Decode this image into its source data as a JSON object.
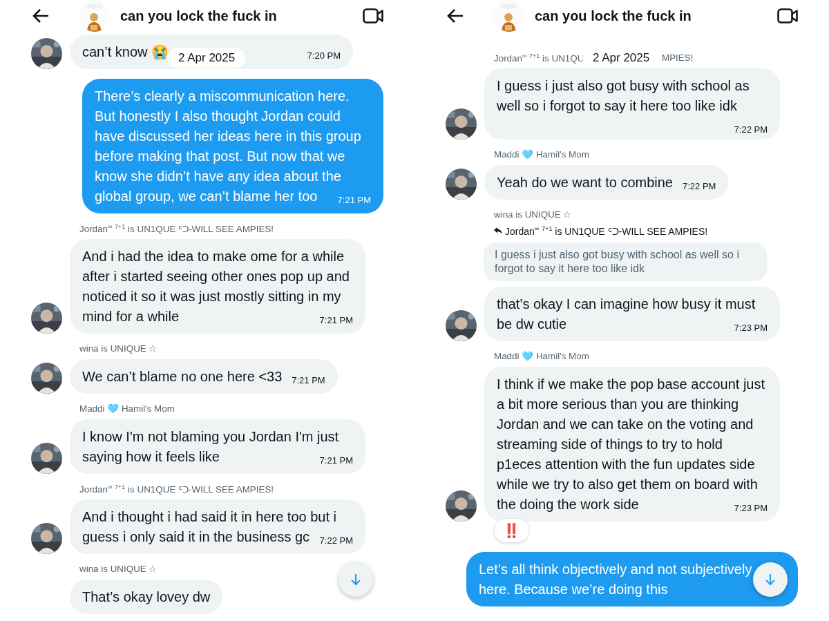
{
  "panels": [
    {
      "header": {
        "title": "can you lock the fuck in"
      },
      "date_pill": "2 Apr 2025",
      "messages": [
        {
          "kind": "incoming",
          "avatar": true,
          "text": "can’t know 😭",
          "time": "7:20 PM"
        },
        {
          "kind": "outgoing",
          "text": "There’s clearly a miscommunication here. But honestly I also thought Jordan could have discussed her ideas here in this group before making that post. But now that we know she didn’t have any idea about the global group, we can’t blame her too",
          "time": "7:21 PM"
        },
        {
          "kind": "incoming",
          "avatar": true,
          "sender": "Jordan$^{∞}$ $^{7+1}$ is UN1QUE ᑦᑐ-WILL SEE AMPIES!",
          "text": "And i had the idea to make ome for a while after i started seeing other ones pop up and noticed it so it was just mostly sitting in my mind for a while",
          "time": "7:21 PM"
        },
        {
          "kind": "incoming",
          "avatar": true,
          "sender": "wina is UNIQUE ☆",
          "text": "We can’t blame no one here <33",
          "time": "7:21 PM"
        },
        {
          "kind": "incoming",
          "avatar": true,
          "sender": "Maddi 🩵 Hamil's Mom",
          "text": "I know I'm not blaming you Jordan I'm just saying how it feels like",
          "time": "7:21 PM"
        },
        {
          "kind": "incoming",
          "avatar": true,
          "sender": "Jordan$^{∞}$ $^{7+1}$ is UN1QUE ᑦᑐ-WILL SEE AMPIES!",
          "text": "And i thought i had said it in here too but i guess i only said it in the business gc",
          "time": "7:22 PM"
        },
        {
          "kind": "incoming",
          "avatar": false,
          "sender": "wina is UNIQUE ☆",
          "text": "That’s okay lovey dw"
        }
      ]
    },
    {
      "header": {
        "title": "can you lock the fuck in"
      },
      "date_pill": "2 Apr 2025",
      "messages": [
        {
          "kind": "incoming",
          "avatar": true,
          "sender_parts": [
            "Jordan$^{∞}$ $^{7+1}$ is UN1QU",
            "MPIES!"
          ],
          "text": "I guess i just also got busy with school as well so i forgot to say it here too like idk",
          "time": "7:22 PM"
        },
        {
          "kind": "incoming",
          "avatar": true,
          "sender": "Maddi 🩵 Hamil's Mom",
          "text": "Yeah do we want to combine",
          "time": "7:22 PM"
        },
        {
          "kind": "incoming",
          "avatar": true,
          "sender": "wina is UNIQUE ☆",
          "reply_to": "Jordan$^{∞}$ $^{7+1}$ is UN1QUE ᑦᑐ-WILL SEE AMPIES!",
          "quote": "I guess i just also got busy with school as well so i forgot to say it here too like idk",
          "text": "that’s okay I can imagine how busy it must be dw cutie",
          "time": "7:23 PM"
        },
        {
          "kind": "incoming",
          "avatar": true,
          "sender": "Maddi 🩵 Hamil's Mom",
          "text": "I think if we make the pop base account just a bit more serious than you are thinking Jordan and we can take on the voting and streaming side of things to try to hold p1eces attention with the fun updates side while we try to also get them on board with the doing the work side",
          "time": "7:23 PM",
          "reaction": "‼️"
        },
        {
          "kind": "outgoing",
          "text": "Let’s all think objectively and not subjectively here. Because we’re doing this"
        }
      ]
    }
  ]
}
